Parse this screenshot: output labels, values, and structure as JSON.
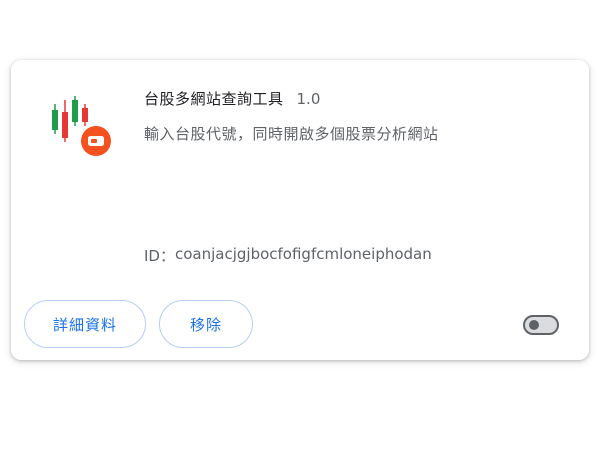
{
  "extension": {
    "name": "台股多網站查詢工具",
    "version": "1.0",
    "description": "輸入台股代號，同時開啟多個股票分析網站",
    "id_label": "ID：",
    "id_value": "coanjacjgjbocfofigfcmloneiphodan",
    "enabled": false
  },
  "buttons": {
    "details_label": "詳細資料",
    "remove_label": "移除"
  },
  "colors": {
    "accent": "#1a73e8",
    "button_border": "#b9cdf3",
    "candle_green": "#1e9e4a",
    "candle_red": "#e53935",
    "badge_orange": "#f4511e",
    "text_primary": "#202124",
    "text_secondary": "#5f6368"
  },
  "icons": {
    "extension_icon": "candlestick-chart-with-video-badge-icon",
    "toggle": "toggle-switch"
  }
}
